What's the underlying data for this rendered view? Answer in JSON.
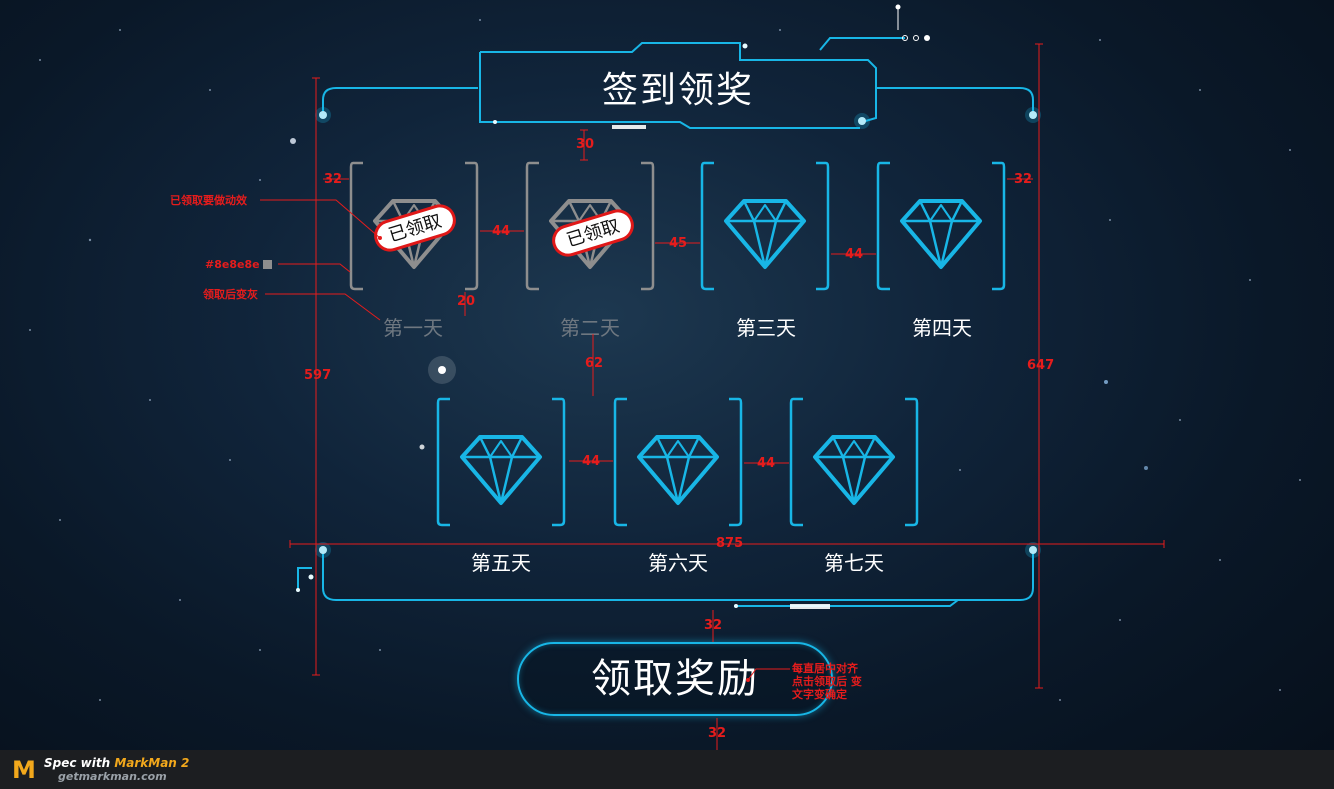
{
  "title": "签到领奖",
  "days": [
    {
      "label": "第一天",
      "claimed": true
    },
    {
      "label": "第二天",
      "claimed": true
    },
    {
      "label": "第三天",
      "claimed": false
    },
    {
      "label": "第四天",
      "claimed": false
    },
    {
      "label": "第五天",
      "claimed": false
    },
    {
      "label": "第六天",
      "claimed": false
    },
    {
      "label": "第七天",
      "claimed": false
    }
  ],
  "claimed_stamp": "已领取",
  "claim_button": "领取奖励",
  "colors": {
    "accent": "#18b6e6",
    "claimed_gray": "#8e8e8e",
    "stamp_red": "#e01818",
    "annotation": "#e51c1c"
  },
  "annotations": {
    "stamp_note": "已领取要做动效",
    "gray_hex": "#8e8e8e",
    "gray_note": "领取后变灰",
    "button_note_1": "每直居中对齐",
    "button_note_2": "点击领取后 变",
    "button_note_3": "文字变确定"
  },
  "dimensions": [
    "30",
    "32",
    "32",
    "44",
    "45",
    "44",
    "20",
    "62",
    "597",
    "647",
    "44",
    "44",
    "875",
    "32",
    "32"
  ],
  "footer": {
    "brand_prefix": "Spec with ",
    "brand_name": "MarkMan 2",
    "site": "getmarkman.com"
  }
}
